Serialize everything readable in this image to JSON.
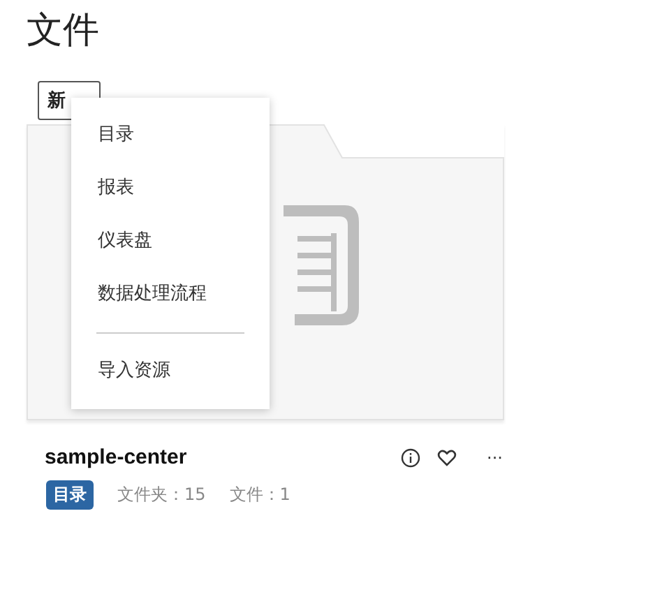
{
  "title": "文件",
  "toolbar": {
    "buttons": [
      {
        "label": "新",
        "kind": "outlined"
      }
    ]
  },
  "menu": {
    "items": [
      {
        "label": "目录",
        "kind": "item"
      },
      {
        "label": "报表",
        "kind": "item"
      },
      {
        "label": "仪表盘",
        "kind": "item"
      },
      {
        "label": "数据处理流程",
        "kind": "item"
      },
      {
        "kind": "divider"
      },
      {
        "label": "导入资源",
        "kind": "item"
      }
    ]
  },
  "card": {
    "name": "sample-center",
    "tag": "目录",
    "stats": [
      "文件夹：15",
      "文件：1"
    ],
    "actions": [
      {
        "kind": "info"
      },
      {
        "kind": "favorite"
      },
      {
        "kind": "more",
        "label": "···"
      }
    ]
  }
}
